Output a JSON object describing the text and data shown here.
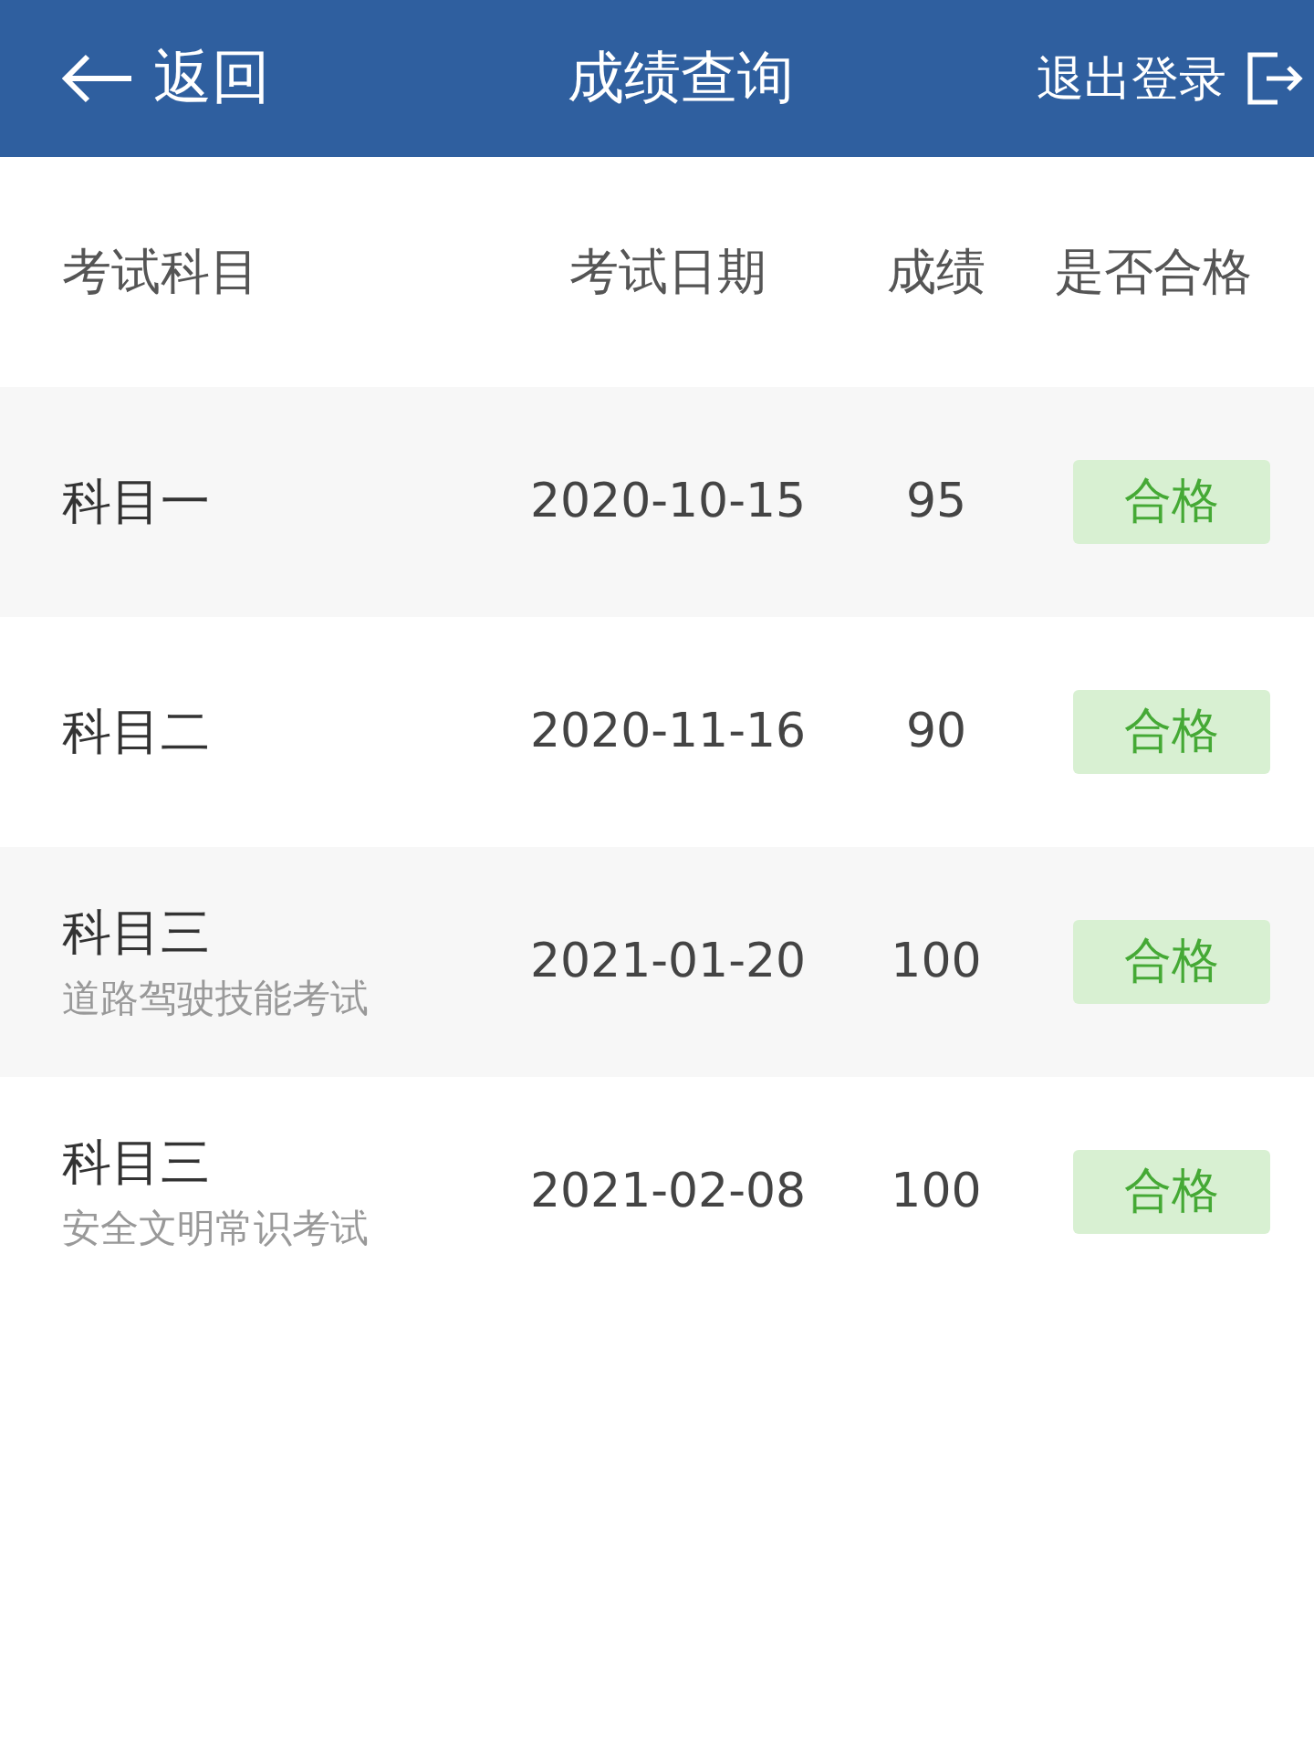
{
  "header": {
    "back": "返回",
    "title": "成绩查询",
    "logout": "退出登录"
  },
  "columns": [
    "考试科目",
    "考试日期",
    "成绩",
    "是否合格"
  ],
  "rows": [
    {
      "subject": "科目一",
      "date": "2020-10-15",
      "score": "95",
      "result": "合格",
      "passed": true
    },
    {
      "subject": "科目二",
      "date": "2020-11-16",
      "score": "90",
      "result": "合格",
      "passed": true
    },
    {
      "subject": "科目三",
      "note": "道路驾驶技能考试",
      "date": "2021-01-20",
      "score": "100",
      "result": "合格",
      "passed": true
    },
    {
      "subject": "科目三",
      "note": "安全文明常识考试",
      "date": "2021-02-08",
      "score": "100",
      "result": "合格",
      "passed": true
    }
  ]
}
